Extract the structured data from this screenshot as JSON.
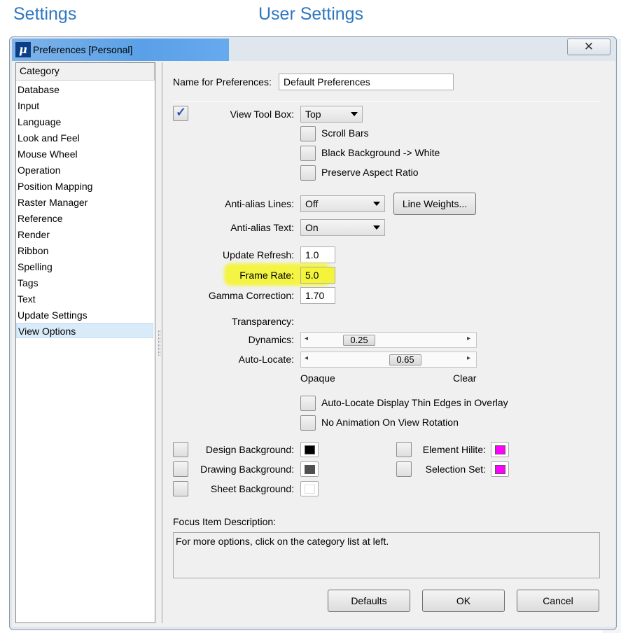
{
  "page": {
    "heading_left": "Settings",
    "heading_right": "User Settings"
  },
  "window": {
    "title": "Preferences [Personal]",
    "icon_glyph": "μ",
    "close_glyph": "✕"
  },
  "category": {
    "header": "Category",
    "items": [
      "Database",
      "Input",
      "Language",
      "Look and Feel",
      "Mouse Wheel",
      "Operation",
      "Position Mapping",
      "Raster Manager",
      "Reference",
      "Render",
      "Ribbon",
      "Spelling",
      "Tags",
      "Text",
      "Update Settings",
      "View Options"
    ],
    "selected": "View Options"
  },
  "prefs": {
    "name_label": "Name for Preferences:",
    "name_value": "Default Preferences",
    "view_tool_box_label": "View Tool Box:",
    "view_tool_box_checked": true,
    "view_tool_box_value": "Top",
    "scroll_bars": "Scroll Bars",
    "black_background": "Black Background -> White",
    "preserve_aspect": "Preserve Aspect Ratio",
    "aa_lines_label": "Anti-alias Lines:",
    "aa_lines_value": "Off",
    "line_weights": "Line Weights...",
    "aa_text_label": "Anti-alias Text:",
    "aa_text_value": "On",
    "update_refresh_label": "Update Refresh:",
    "update_refresh_value": "1.0",
    "frame_rate_label": "Frame Rate:",
    "frame_rate_value": "5.0",
    "gamma_label": "Gamma Correction:",
    "gamma_value": "1.70",
    "transparency_label": "Transparency:",
    "dynamics_label": "Dynamics:",
    "dynamics_value": "0.25",
    "autolocate_label": "Auto-Locate:",
    "autolocate_value": "0.65",
    "opaque": "Opaque",
    "clear": "Clear",
    "thin_edges": "Auto-Locate Display Thin Edges in Overlay",
    "no_animation": "No Animation On View Rotation",
    "design_bg": "Design Background:",
    "drawing_bg": "Drawing Background:",
    "sheet_bg": "Sheet Background:",
    "element_hilite": "Element Hilite:",
    "selection_set": "Selection Set:",
    "colors": {
      "design_bg": "#000000",
      "drawing_bg": "#4f4f4f",
      "sheet_bg": "#ffffff",
      "element_hilite": "#ff00ff",
      "selection_set": "#ff00ff",
      "highlight": "#f4f53a"
    },
    "focus_label": "Focus Item Description:",
    "focus_text": "For more options, click on the category list at left."
  },
  "buttons": {
    "defaults": "Defaults",
    "ok": "OK",
    "cancel": "Cancel"
  }
}
